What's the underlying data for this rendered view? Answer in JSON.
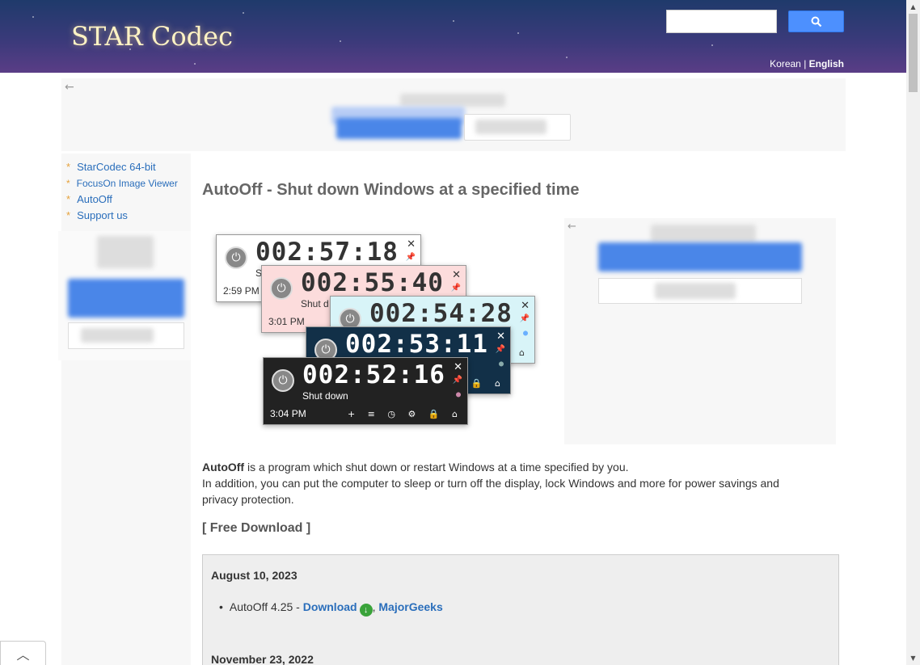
{
  "header": {
    "logo": "STAR Codec",
    "lang_korean": "Korean",
    "lang_sep": "|",
    "lang_english": "English"
  },
  "search": {
    "placeholder": "",
    "button_icon": "search-icon"
  },
  "sidebar": {
    "items": [
      {
        "label": "StarCodec 64-bit"
      },
      {
        "label": "FocusOn Image Viewer"
      },
      {
        "label": "AutoOff"
      },
      {
        "label": "Support us"
      }
    ]
  },
  "main": {
    "title": "AutoOff - Shut down Windows at a specified time",
    "timers": [
      {
        "time": "002:57:18",
        "clock": "2:59 PM",
        "sub": "S"
      },
      {
        "time": "002:55:40",
        "clock": "3:01 PM",
        "sub": "Shut d"
      },
      {
        "time": "002:54:28",
        "clock": "",
        "sub": ""
      },
      {
        "time": "002:53:11",
        "clock": "",
        "sub": ""
      },
      {
        "time": "002:52:16",
        "clock": "3:04 PM",
        "sub": "Shut down"
      }
    ],
    "desc_name": "AutoOff",
    "desc_line1": " is a program which shut down or restart Windows at a time specified by you.",
    "desc_line2": "In addition, you can put the computer to sleep or turn off the display, lock Windows and more for power savings and privacy protection.",
    "free_download": "[ Free Download ]",
    "downloads": {
      "date1": "August 10, 2023",
      "item_prefix": "AutoOff 4.25 - ",
      "download_link": "Download",
      "comma": ", ",
      "majorgeeks_link": "MajorGeeks",
      "date2": "November 23, 2022"
    }
  },
  "colors": {
    "accent": "#2a6ebb",
    "header_top": "#1f3a6b",
    "header_bottom": "#5a3d86"
  }
}
